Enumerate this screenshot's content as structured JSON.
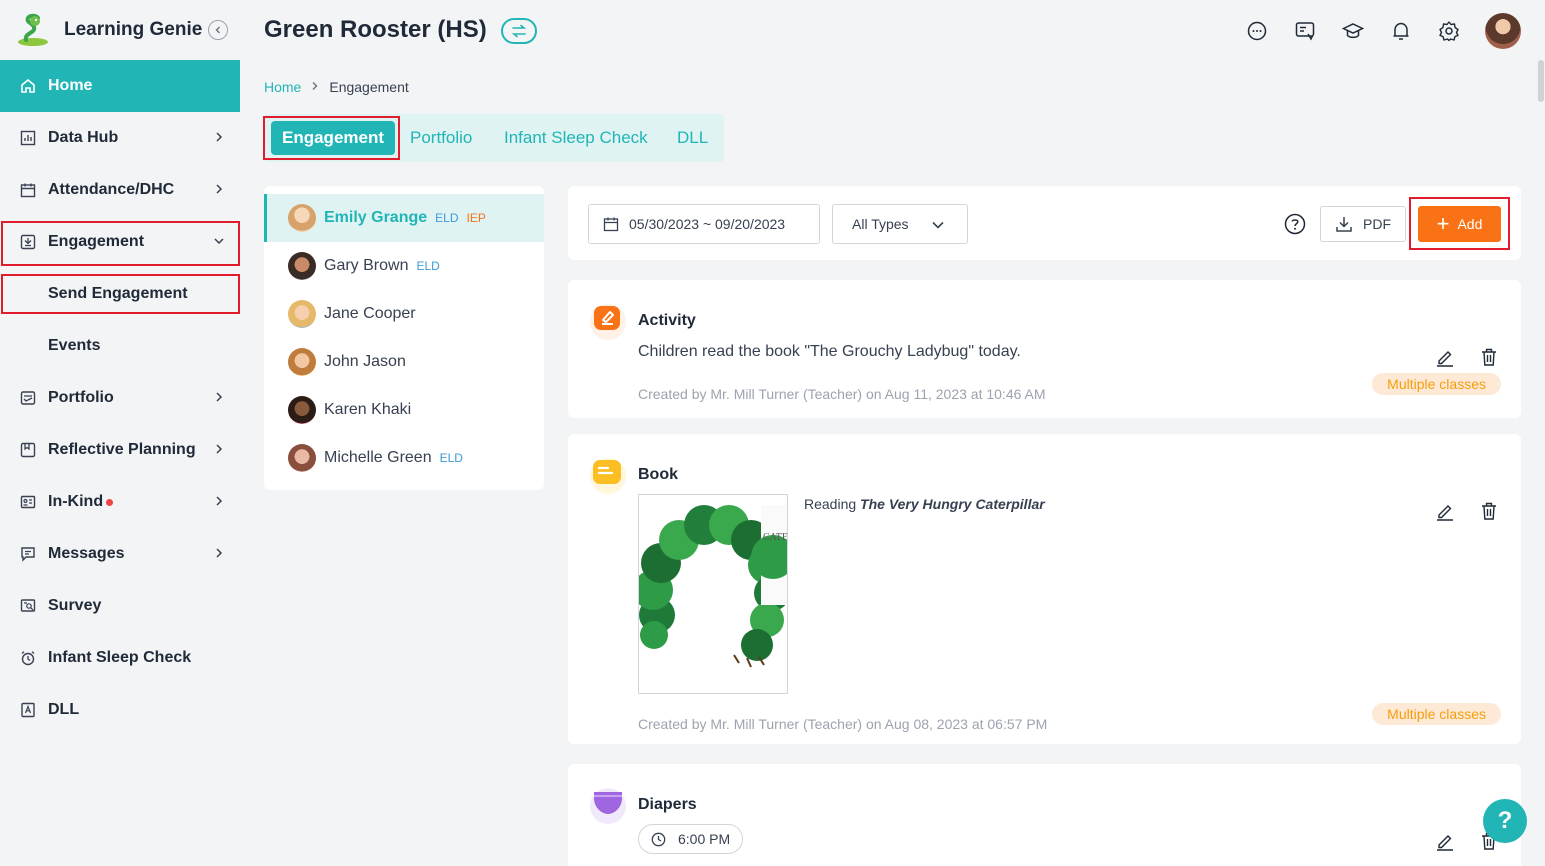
{
  "app": {
    "name": "Learning Genie"
  },
  "sidebar": {
    "items": [
      {
        "label": "Home",
        "icon": "home-icon"
      },
      {
        "label": "Data Hub",
        "icon": "chart-icon"
      },
      {
        "label": "Attendance/DHC",
        "icon": "calendar-icon"
      },
      {
        "label": "Engagement",
        "icon": "engagement-icon"
      },
      {
        "label": "Send Engagement"
      },
      {
        "label": "Events"
      },
      {
        "label": "Portfolio",
        "icon": "portfolio-icon"
      },
      {
        "label": "Reflective Planning",
        "icon": "planning-icon"
      },
      {
        "label": "In-Kind",
        "icon": "inkind-icon"
      },
      {
        "label": "Messages",
        "icon": "message-icon"
      },
      {
        "label": "Survey",
        "icon": "survey-icon"
      },
      {
        "label": "Infant Sleep Check",
        "icon": "alarm-icon"
      },
      {
        "label": "DLL",
        "icon": "dll-icon"
      }
    ]
  },
  "header": {
    "title": "Green Rooster (HS)"
  },
  "breadcrumb": {
    "home": "Home",
    "current": "Engagement"
  },
  "tabs": [
    "Engagement",
    "Portfolio",
    "Infant Sleep Check",
    "DLL"
  ],
  "students": [
    {
      "name": "Emily Grange",
      "tags": [
        "ELD",
        "IEP"
      ]
    },
    {
      "name": "Gary Brown",
      "tags": [
        "ELD"
      ]
    },
    {
      "name": "Jane Cooper",
      "tags": []
    },
    {
      "name": "John Jason",
      "tags": []
    },
    {
      "name": "Karen Khaki",
      "tags": []
    },
    {
      "name": "Michelle Green",
      "tags": [
        "ELD"
      ]
    }
  ],
  "toolbar": {
    "date_range": "05/30/2023 ~ 09/20/2023",
    "type_filter": "All Types",
    "pdf_label": "PDF",
    "add_label": "Add"
  },
  "entries": [
    {
      "type": "Activity",
      "description": "Children read the book \"The Grouchy Ladybug\" today.",
      "meta": "Created by Mr. Mill Turner (Teacher) on Aug 11, 2023 at 10:46 AM",
      "badge": "Multiple classes"
    },
    {
      "type": "Book",
      "reading_prefix": "Reading",
      "book_title": "The Very Hungry Caterpillar",
      "meta": "Created by Mr. Mill Turner (Teacher) on Aug 08, 2023 at 06:57 PM",
      "badge": "Multiple classes"
    },
    {
      "type": "Diapers",
      "time": "6:00 PM"
    }
  ],
  "help_fab": "?",
  "colors": {
    "accent": "#22b5b6",
    "orange": "#f97316",
    "highlight_box": "#e11d2d"
  }
}
